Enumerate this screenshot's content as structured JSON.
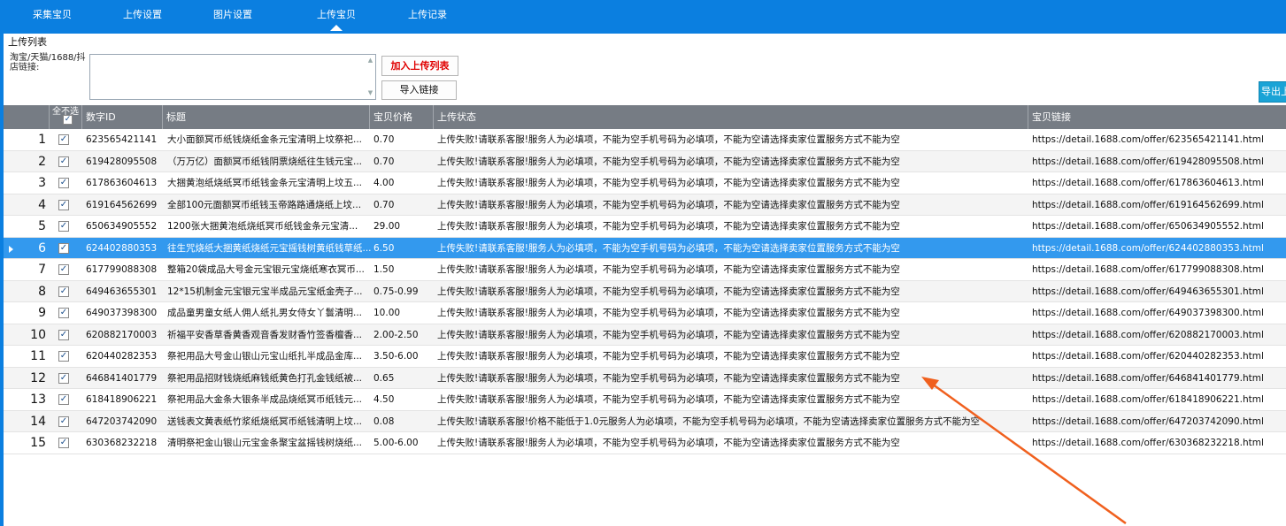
{
  "nav": {
    "tabs": [
      {
        "label": "采集宝贝",
        "active": false
      },
      {
        "label": "上传设置",
        "active": false
      },
      {
        "label": "图片设置",
        "active": false
      },
      {
        "label": "上传宝贝",
        "active": true
      },
      {
        "label": "上传记录",
        "active": false
      }
    ],
    "accent_color": "#0b7fe0"
  },
  "section_title": "上传列表",
  "link_input": {
    "label": "淘宝/天猫/1688/抖店链接:",
    "value": ""
  },
  "buttons": {
    "add_label": "加入上传列表",
    "import_label": "导入链接",
    "export_label": "导出上"
  },
  "table": {
    "columns": {
      "check_all": "全不选",
      "id": "数字ID",
      "title": "标题",
      "price": "宝贝价格",
      "status": "上传状态",
      "link": "宝贝链接"
    },
    "selected_row": 6,
    "rows": [
      {
        "num": "1",
        "id": "623565421141",
        "title": "大小面额冥币纸钱烧纸金条元宝清明上坟祭祀...",
        "price": "0.70",
        "status": "上传失败!请联系客服!服务人为必填项，不能为空手机号码为必填项，不能为空请选择卖家位置服务方式不能为空",
        "link": "https://detail.1688.com/offer/623565421141.html"
      },
      {
        "num": "2",
        "id": "619428095508",
        "title": "（万万亿）面额冥币纸钱阴票烧纸往生钱元宝...",
        "price": "0.70",
        "status": "上传失败!请联系客服!服务人为必填项，不能为空手机号码为必填项，不能为空请选择卖家位置服务方式不能为空",
        "link": "https://detail.1688.com/offer/619428095508.html"
      },
      {
        "num": "3",
        "id": "617863604613",
        "title": "大捆黄泡纸烧纸冥币纸钱金条元宝清明上坟五...",
        "price": "4.00",
        "status": "上传失败!请联系客服!服务人为必填项，不能为空手机号码为必填项，不能为空请选择卖家位置服务方式不能为空",
        "link": "https://detail.1688.com/offer/617863604613.html"
      },
      {
        "num": "4",
        "id": "619164562699",
        "title": "全部100元面额冥币纸钱玉帝路路通烧纸上坟...",
        "price": "0.70",
        "status": "上传失败!请联系客服!服务人为必填项，不能为空手机号码为必填项，不能为空请选择卖家位置服务方式不能为空",
        "link": "https://detail.1688.com/offer/619164562699.html"
      },
      {
        "num": "5",
        "id": "650634905552",
        "title": "1200张大捆黄泡纸烧纸冥币纸钱金条元宝清...",
        "price": "29.00",
        "status": "上传失败!请联系客服!服务人为必填项，不能为空手机号码为必填项，不能为空请选择卖家位置服务方式不能为空",
        "link": "https://detail.1688.com/offer/650634905552.html"
      },
      {
        "num": "6",
        "id": "624402880353",
        "title": "往生咒烧纸大捆黄纸烧纸元宝摇钱树黄纸钱草纸...",
        "price": "6.50",
        "status": "上传失败!请联系客服!服务人为必填项，不能为空手机号码为必填项，不能为空请选择卖家位置服务方式不能为空",
        "link": "https://detail.1688.com/offer/624402880353.html"
      },
      {
        "num": "7",
        "id": "617799088308",
        "title": "整箱20袋成品大号金元宝银元宝烧纸寒衣冥币...",
        "price": "1.50",
        "status": "上传失败!请联系客服!服务人为必填项，不能为空手机号码为必填项，不能为空请选择卖家位置服务方式不能为空",
        "link": "https://detail.1688.com/offer/617799088308.html"
      },
      {
        "num": "8",
        "id": "649463655301",
        "title": "12*15机制金元宝银元宝半成品元宝纸金壳子...",
        "price": "0.75-0.99",
        "status": "上传失败!请联系客服!服务人为必填项，不能为空手机号码为必填项，不能为空请选择卖家位置服务方式不能为空",
        "link": "https://detail.1688.com/offer/649463655301.html"
      },
      {
        "num": "9",
        "id": "649037398300",
        "title": "成品童男童女纸人佣人纸扎男女侍女丫鬟清明...",
        "price": "10.00",
        "status": "上传失败!请联系客服!服务人为必填项，不能为空手机号码为必填项，不能为空请选择卖家位置服务方式不能为空",
        "link": "https://detail.1688.com/offer/649037398300.html"
      },
      {
        "num": "10",
        "id": "620882170003",
        "title": "祈福平安香草香黄香观音香发财香竹签香檀香...",
        "price": "2.00-2.50",
        "status": "上传失败!请联系客服!服务人为必填项，不能为空手机号码为必填项，不能为空请选择卖家位置服务方式不能为空",
        "link": "https://detail.1688.com/offer/620882170003.html"
      },
      {
        "num": "11",
        "id": "620440282353",
        "title": "祭祀用品大号金山银山元宝山纸扎半成品金库...",
        "price": "3.50-6.00",
        "status": "上传失败!请联系客服!服务人为必填项，不能为空手机号码为必填项，不能为空请选择卖家位置服务方式不能为空",
        "link": "https://detail.1688.com/offer/620440282353.html"
      },
      {
        "num": "12",
        "id": "646841401779",
        "title": "祭祀用品招财钱烧纸麻钱纸黄色打孔金钱纸被...",
        "price": "0.65",
        "status": "上传失败!请联系客服!服务人为必填项，不能为空手机号码为必填项，不能为空请选择卖家位置服务方式不能为空",
        "link": "https://detail.1688.com/offer/646841401779.html"
      },
      {
        "num": "13",
        "id": "618418906221",
        "title": "祭祀用品大金条大银条半成品烧纸冥币纸钱元...",
        "price": "4.50",
        "status": "上传失败!请联系客服!服务人为必填项，不能为空手机号码为必填项，不能为空请选择卖家位置服务方式不能为空",
        "link": "https://detail.1688.com/offer/618418906221.html"
      },
      {
        "num": "14",
        "id": "647203742090",
        "title": "送钱表文黄表纸竹浆纸烧纸冥币纸钱清明上坟...",
        "price": "0.08",
        "status": "上传失败!请联系客服!价格不能低于1.0元服务人为必填项，不能为空手机号码为必填项，不能为空请选择卖家位置服务方式不能为空",
        "link": "https://detail.1688.com/offer/647203742090.html"
      },
      {
        "num": "15",
        "id": "630368232218",
        "title": "清明祭祀金山银山元宝金条聚宝盆摇钱树烧纸...",
        "price": "5.00-6.00",
        "status": "上传失败!请联系客服!服务人为必填项，不能为空手机号码为必填项，不能为空请选择卖家位置服务方式不能为空",
        "link": "https://detail.1688.com/offer/630368232218.html"
      }
    ]
  },
  "colors": {
    "header_bg": "#767c84",
    "selected_row": "#3399ee",
    "add_button_text": "#e00000",
    "export_button": "#1aa3d6",
    "annotation_arrow": "#f0601e"
  }
}
